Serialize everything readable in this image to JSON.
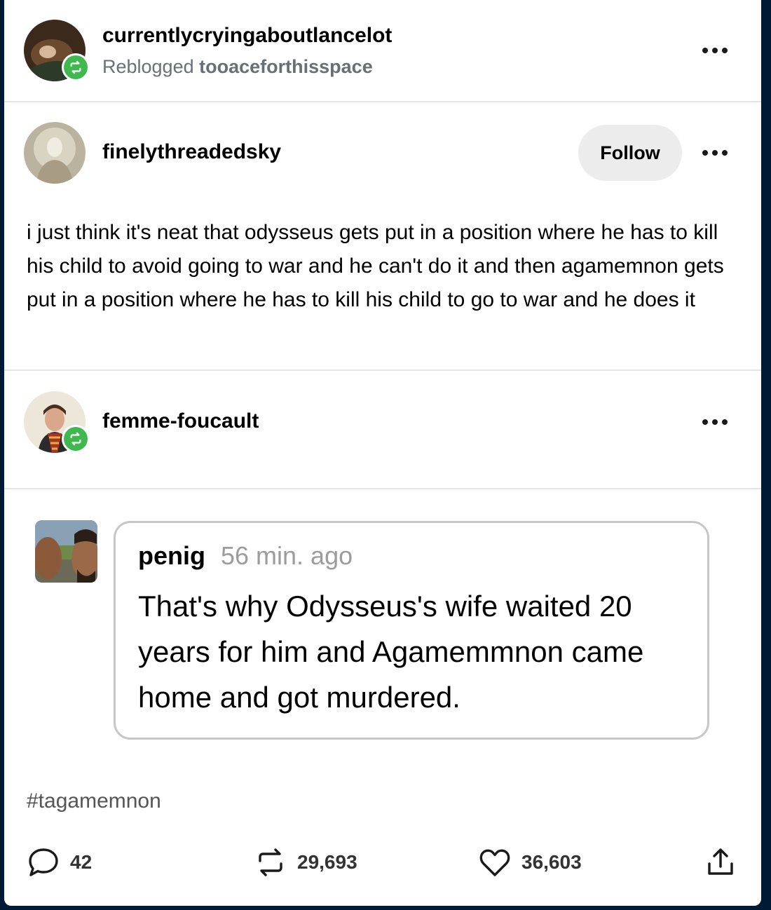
{
  "reblogger": {
    "username": "currentlycryingaboutlancelot",
    "reblogged_label": "Reblogged",
    "reblogged_from": "tooaceforthisspace"
  },
  "original_post": {
    "username": "finelythreadedsky",
    "follow_label": "Follow",
    "text": "i just think it's neat that odysseus gets put in a position where he has to kill his child to avoid going to war and he can't do it and then agamemnon gets put in a position where he has to kill his child to go to war and he does it"
  },
  "reblog": {
    "username": "femme-foucault"
  },
  "quote": {
    "username": "penig",
    "time": "56 min. ago",
    "text": "That's why Odysseus's wife waited 20 years for him and Agamemmnon came home and got murdered."
  },
  "tags": [
    "#tagamemnon"
  ],
  "footer": {
    "replies": "42",
    "reblogs": "29,693",
    "likes": "36,603"
  },
  "colors": {
    "background": "#001935",
    "reblog_green": "#3fb94f",
    "follow_button": "#ececec"
  }
}
